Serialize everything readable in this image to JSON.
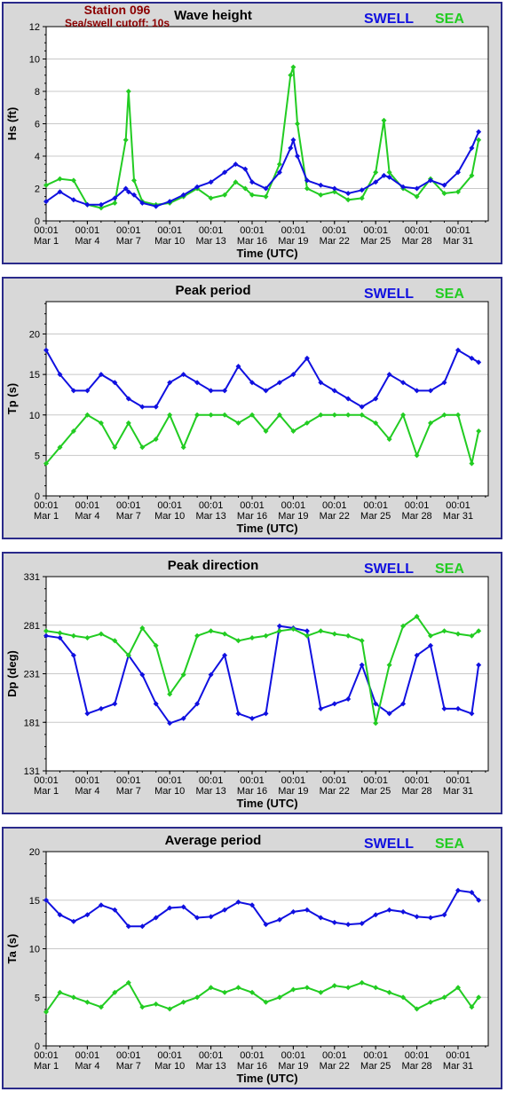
{
  "header": {
    "station": "Station 096",
    "cutoff": "Sea/swell cutoff: 10s"
  },
  "legend": {
    "swell": "SWELL",
    "sea": "SEA",
    "swell_color": "#1010e0",
    "sea_color": "#22cc22"
  },
  "x_axis": {
    "label": "Time (UTC)",
    "ticks": [
      {
        "top": "00:01",
        "bottom": "Mar 1"
      },
      {
        "top": "00:01",
        "bottom": "Mar 4"
      },
      {
        "top": "00:01",
        "bottom": "Mar 7"
      },
      {
        "top": "00:01",
        "bottom": "Mar 10"
      },
      {
        "top": "00:01",
        "bottom": "Mar 13"
      },
      {
        "top": "00:01",
        "bottom": "Mar 16"
      },
      {
        "top": "00:01",
        "bottom": "Mar 19"
      },
      {
        "top": "00:01",
        "bottom": "Mar 22"
      },
      {
        "top": "00:01",
        "bottom": "Mar 25"
      },
      {
        "top": "00:01",
        "bottom": "Mar 28"
      },
      {
        "top": "00:01",
        "bottom": "Mar 31"
      }
    ]
  },
  "chart_data": [
    {
      "type": "line",
      "title": "Wave height",
      "xlabel": "Time (UTC)",
      "ylabel": "Hs (ft)",
      "ylim": [
        0,
        12
      ],
      "yticks": [
        0,
        2,
        4,
        6,
        8,
        10,
        12
      ],
      "grid": true,
      "legend_position": "top-right",
      "x": [
        1,
        2,
        3,
        4,
        5,
        6,
        6.8,
        7,
        7.4,
        8,
        9,
        10,
        11,
        12,
        13,
        14,
        14.8,
        15.5,
        16,
        17,
        18,
        18.8,
        19,
        19.3,
        20,
        21,
        22,
        23,
        24,
        25,
        25.6,
        26,
        27,
        28,
        29,
        30,
        31,
        32,
        32.5
      ],
      "series": [
        {
          "name": "SWELL",
          "values": [
            1.2,
            1.8,
            1.3,
            1.0,
            1.0,
            1.4,
            2.0,
            1.8,
            1.6,
            1.1,
            0.9,
            1.2,
            1.6,
            2.1,
            2.4,
            3.0,
            3.5,
            3.2,
            2.4,
            2.0,
            3.0,
            4.5,
            5.0,
            4.0,
            2.5,
            2.2,
            2.0,
            1.7,
            1.9,
            2.4,
            2.8,
            2.7,
            2.1,
            2.0,
            2.5,
            2.2,
            3.0,
            4.5,
            5.5
          ]
        },
        {
          "name": "SEA",
          "values": [
            2.2,
            2.6,
            2.5,
            1.0,
            0.8,
            1.1,
            5.0,
            8.0,
            2.5,
            1.2,
            1.0,
            1.1,
            1.5,
            2.0,
            1.4,
            1.6,
            2.4,
            2.0,
            1.6,
            1.5,
            3.5,
            9.0,
            9.5,
            6.0,
            2.0,
            1.6,
            1.8,
            1.3,
            1.4,
            3.0,
            6.2,
            3.0,
            2.0,
            1.5,
            2.6,
            1.7,
            1.8,
            2.8,
            5.0
          ]
        }
      ]
    },
    {
      "type": "scatter",
      "title": "Peak period",
      "xlabel": "Time (UTC)",
      "ylabel": "Tp (s)",
      "ylim": [
        0,
        24
      ],
      "yticks": [
        0,
        5,
        10,
        15,
        20
      ],
      "grid": true,
      "legend_position": "top-right",
      "x": [
        1,
        2,
        3,
        4,
        5,
        6,
        7,
        8,
        9,
        10,
        11,
        12,
        13,
        14,
        15,
        16,
        17,
        18,
        19,
        20,
        21,
        22,
        23,
        24,
        25,
        26,
        27,
        28,
        29,
        30,
        31,
        32,
        32.5
      ],
      "series": [
        {
          "name": "SWELL",
          "values": [
            18,
            15,
            13,
            13,
            15,
            14,
            12,
            11,
            11,
            14,
            15,
            14,
            13,
            13,
            16,
            14,
            13,
            14,
            15,
            17,
            14,
            13,
            12,
            11,
            12,
            15,
            14,
            13,
            13,
            14,
            18,
            17,
            16.5
          ]
        },
        {
          "name": "SEA",
          "values": [
            4,
            6,
            8,
            10,
            9,
            6,
            9,
            6,
            7,
            10,
            6,
            10,
            10,
            10,
            9,
            10,
            8,
            10,
            8,
            9,
            10,
            10,
            10,
            10,
            9,
            7,
            10,
            5,
            9,
            10,
            10,
            4,
            8
          ]
        }
      ]
    },
    {
      "type": "scatter",
      "title": "Peak direction",
      "xlabel": "Time (UTC)",
      "ylabel": "Dp (deg)",
      "ylim": [
        131,
        331
      ],
      "yticks": [
        131,
        181,
        231,
        281,
        331
      ],
      "grid": true,
      "legend_position": "top-right",
      "x": [
        1,
        2,
        3,
        4,
        5,
        6,
        7,
        8,
        9,
        10,
        11,
        12,
        13,
        14,
        15,
        16,
        17,
        18,
        19,
        20,
        21,
        22,
        23,
        24,
        25,
        26,
        27,
        28,
        29,
        30,
        31,
        32,
        32.5
      ],
      "series": [
        {
          "name": "SWELL",
          "values": [
            270,
            268,
            250,
            190,
            195,
            200,
            250,
            230,
            200,
            180,
            185,
            200,
            230,
            250,
            190,
            185,
            190,
            280,
            278,
            275,
            195,
            200,
            205,
            240,
            200,
            190,
            200,
            250,
            260,
            195,
            195,
            190,
            240
          ]
        },
        {
          "name": "SEA",
          "values": [
            275,
            273,
            270,
            268,
            272,
            265,
            250,
            278,
            260,
            210,
            230,
            270,
            275,
            272,
            265,
            268,
            270,
            275,
            277,
            270,
            275,
            272,
            270,
            265,
            180,
            240,
            280,
            290,
            270,
            275,
            272,
            270,
            275
          ]
        }
      ]
    },
    {
      "type": "line",
      "title": "Average period",
      "xlabel": "Time (UTC)",
      "ylabel": "Ta (s)",
      "ylim": [
        0,
        20
      ],
      "yticks": [
        0,
        5,
        10,
        15,
        20
      ],
      "grid": true,
      "legend_position": "top-right",
      "x": [
        1,
        2,
        3,
        4,
        5,
        6,
        7,
        8,
        9,
        10,
        11,
        12,
        13,
        14,
        15,
        16,
        17,
        18,
        19,
        20,
        21,
        22,
        23,
        24,
        25,
        26,
        27,
        28,
        29,
        30,
        31,
        32,
        32.5
      ],
      "series": [
        {
          "name": "SWELL",
          "values": [
            15,
            13.5,
            12.8,
            13.5,
            14.5,
            14,
            12.3,
            12.3,
            13.2,
            14.2,
            14.3,
            13.2,
            13.3,
            14,
            14.8,
            14.5,
            12.5,
            13,
            13.8,
            14,
            13.2,
            12.7,
            12.5,
            12.6,
            13.5,
            14,
            13.8,
            13.3,
            13.2,
            13.5,
            16,
            15.8,
            15
          ]
        },
        {
          "name": "SEA",
          "values": [
            3.5,
            5.5,
            5.0,
            4.5,
            4.0,
            5.5,
            6.5,
            4.0,
            4.3,
            3.8,
            4.5,
            5.0,
            6.0,
            5.5,
            6.0,
            5.5,
            4.5,
            5.0,
            5.8,
            6.0,
            5.5,
            6.2,
            6.0,
            6.5,
            6.0,
            5.5,
            5.0,
            3.8,
            4.5,
            5.0,
            6.0,
            4.0,
            5.0
          ]
        }
      ]
    }
  ]
}
